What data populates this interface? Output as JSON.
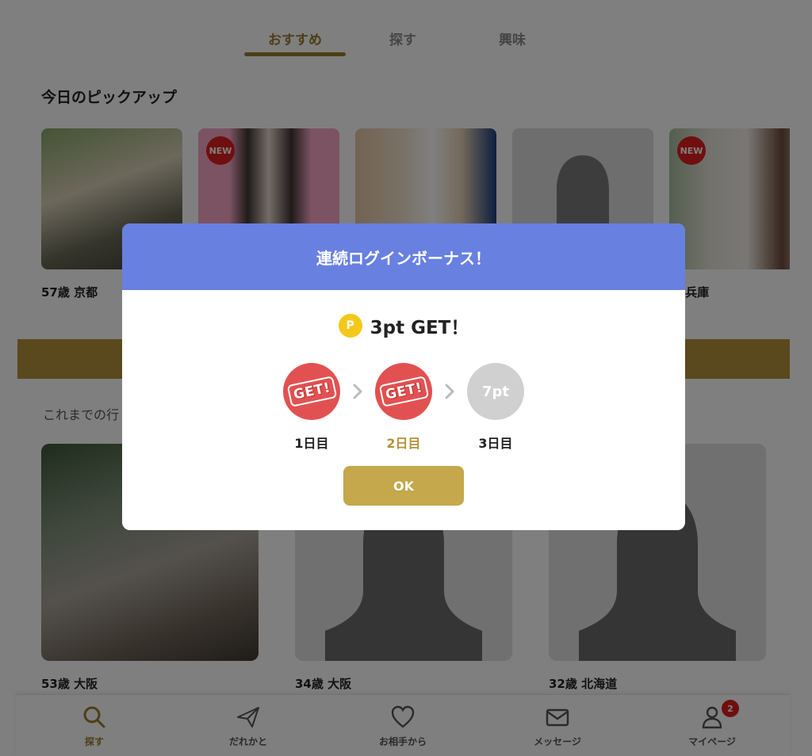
{
  "tabs": [
    "おすすめ",
    "探す",
    "興味"
  ],
  "pickup": {
    "title": "今日のピックアップ",
    "items": [
      {
        "caption": "57歳 京都",
        "new": false
      },
      {
        "caption": "",
        "new": true
      },
      {
        "caption": "",
        "new": false
      },
      {
        "caption": "",
        "new": false
      },
      {
        "caption": "歳 兵庫",
        "new": true
      }
    ],
    "new_badge": "NEW"
  },
  "history": {
    "title": "これまでの行",
    "items": [
      {
        "caption": "53歳 大阪"
      },
      {
        "caption": "34歳 大阪"
      },
      {
        "caption": "32歳 北海道"
      }
    ]
  },
  "bottom_nav": [
    {
      "label": "探す",
      "icon": "search-icon"
    },
    {
      "label": "だれかと",
      "icon": "paper-plane-icon"
    },
    {
      "label": "お相手から",
      "icon": "heart-icon"
    },
    {
      "label": "メッセージ",
      "icon": "mail-icon"
    },
    {
      "label": "マイページ",
      "icon": "user-icon",
      "badge": "2"
    }
  ],
  "modal": {
    "title": "連続ログインボーナス！",
    "coin_label": "P",
    "headline": "3pt GET！",
    "days": [
      {
        "label": "1日目",
        "stamp": "GET!"
      },
      {
        "label": "2日目",
        "stamp": "GET!"
      },
      {
        "label": "3日目",
        "value": "7pt"
      }
    ],
    "ok": "OK"
  },
  "colors": {
    "accent_gold": "#b5923a",
    "modal_header": "#6880e0",
    "stamp_red": "#e25151",
    "badge_red": "#e11f1f"
  }
}
